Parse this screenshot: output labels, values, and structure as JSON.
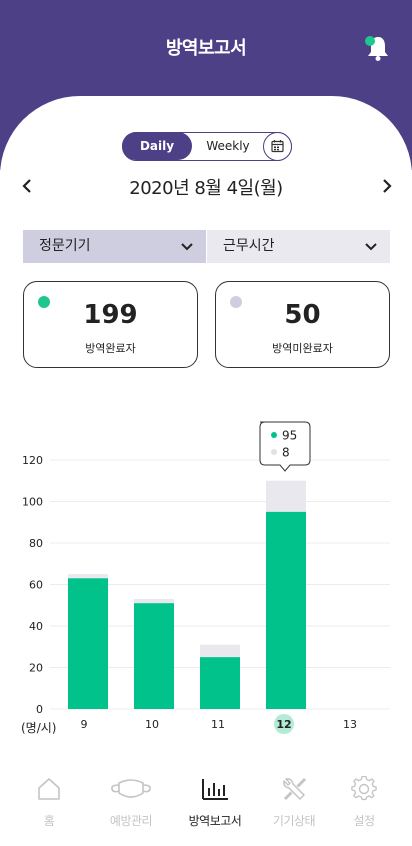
{
  "header": {
    "title": "방역보고서"
  },
  "view_toggle": {
    "daily_label": "Daily",
    "weekly_label": "Weekly",
    "selected": "Daily"
  },
  "date": {
    "label": "2020년 8월 4일(월)"
  },
  "filters": {
    "device": "정문기기",
    "time": "근무시간"
  },
  "cards": [
    {
      "value": "199",
      "label": "방역완료자",
      "color": "#1fc78f"
    },
    {
      "value": "50",
      "label": "방역미완료자",
      "color": "#cfcde0"
    }
  ],
  "tooltip": {
    "completed": "95",
    "incomplete": "8"
  },
  "chart_data": {
    "type": "bar",
    "stacked": true,
    "categories": [
      "9",
      "10",
      "11",
      "12",
      "13"
    ],
    "highlighted_category": "12",
    "series": [
      {
        "values": [
          63,
          51,
          25,
          95,
          0
        ],
        "color": "#00c28a"
      },
      {
        "values": [
          2,
          2,
          6,
          15,
          0
        ],
        "color": "#e8e8ee"
      }
    ],
    "yticks": [
      "0",
      "20",
      "40",
      "60",
      "80",
      "100",
      "120"
    ],
    "ylim": [
      0,
      120
    ],
    "xlabel": "(명/시)",
    "grid": true
  },
  "tabs": [
    {
      "label": "홈",
      "icon": "home-icon"
    },
    {
      "label": "예방관리",
      "icon": "mask-icon"
    },
    {
      "label": "방역보고서",
      "icon": "bar-chart-icon",
      "active": true
    },
    {
      "label": "기기상태",
      "icon": "tools-icon"
    },
    {
      "label": "설정",
      "icon": "gear-icon"
    }
  ]
}
